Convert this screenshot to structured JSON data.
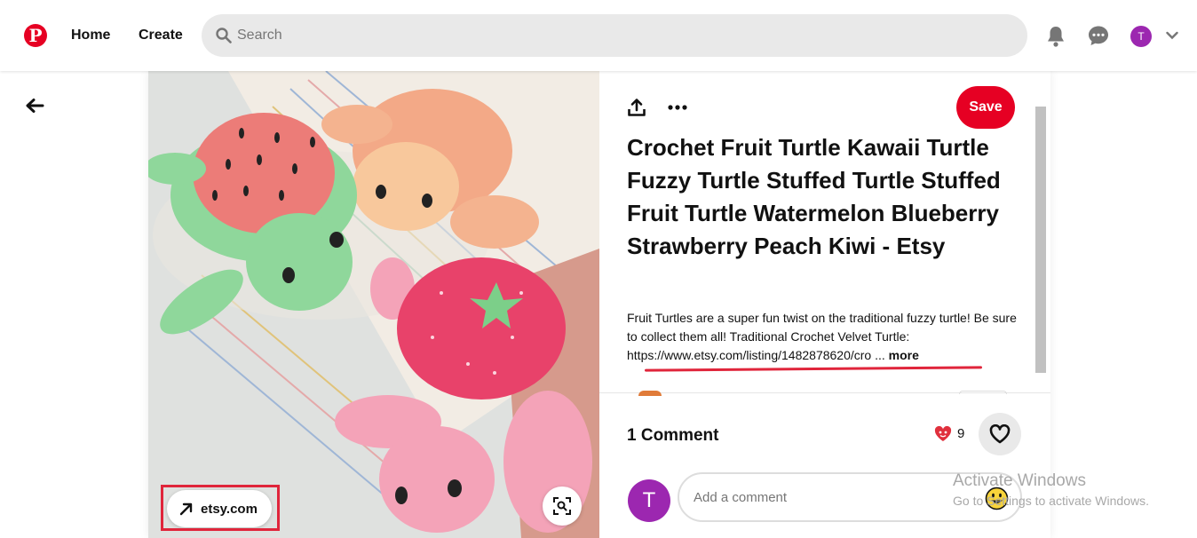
{
  "header": {
    "logo_letter": "P",
    "nav": [
      {
        "label": "Home"
      },
      {
        "label": "Create"
      }
    ],
    "search_placeholder": "Search",
    "avatar_initial": "T"
  },
  "pin": {
    "source_domain": "etsy.com",
    "save_label": "Save",
    "title": "Crochet Fruit Turtle Kawaii Turtle Fuzzy Turtle Stuffed Turtle Stuffed Fruit Turtle Watermelon Blueberry Strawberry Peach Kiwi - Etsy",
    "description_text": "Fruit Turtles are a super fun twist on the traditional fuzzy turtle! Be sure to collect them all! Traditional Crochet Velvet Turtle: ",
    "description_link": "https://www.etsy.com/listing/1482878620/cro",
    "description_ellipsis": " ...",
    "more_label": "more"
  },
  "comments": {
    "count_label": "1 Comment",
    "reaction_count": "9",
    "avatar_initial": "T",
    "input_placeholder": "Add a comment"
  },
  "watermark": {
    "line1": "Activate Windows",
    "line2": "Go to Settings to activate Windows."
  },
  "colors": {
    "brand_red": "#e60023",
    "avatar_purple": "#9c27b0",
    "annotation_red": "#e0253b"
  }
}
